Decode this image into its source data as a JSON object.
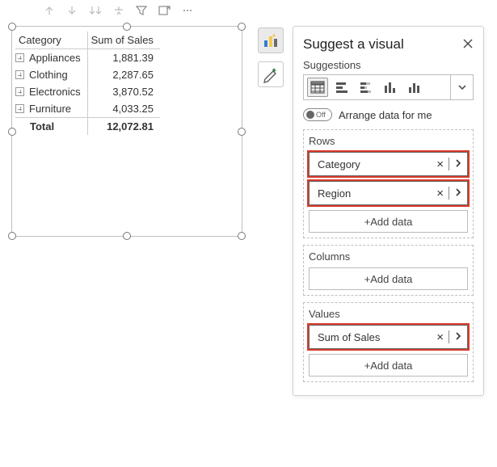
{
  "toolbar": {
    "icons": [
      "arrow-up",
      "arrow-down",
      "arrows-down",
      "sort-pop",
      "filter",
      "export",
      "more"
    ]
  },
  "matrix": {
    "headers": {
      "category": "Category",
      "value": "Sum of Sales"
    },
    "rows": [
      {
        "label": "Appliances",
        "value": "1,881.39"
      },
      {
        "label": "Clothing",
        "value": "2,287.65"
      },
      {
        "label": "Electronics",
        "value": "3,870.52"
      },
      {
        "label": "Furniture",
        "value": "4,033.25"
      }
    ],
    "total": {
      "label": "Total",
      "value": "12,072.81"
    }
  },
  "panel": {
    "title": "Suggest a visual",
    "suggestions_label": "Suggestions",
    "arrange": {
      "toggle_state": "Off",
      "label": "Arrange data for me"
    },
    "wells": {
      "rows_label": "Rows",
      "columns_label": "Columns",
      "values_label": "Values",
      "add_label": "+Add data",
      "rows": [
        {
          "name": "Category"
        },
        {
          "name": "Region"
        }
      ],
      "columns": [],
      "values": [
        {
          "name": "Sum of Sales"
        }
      ]
    }
  }
}
